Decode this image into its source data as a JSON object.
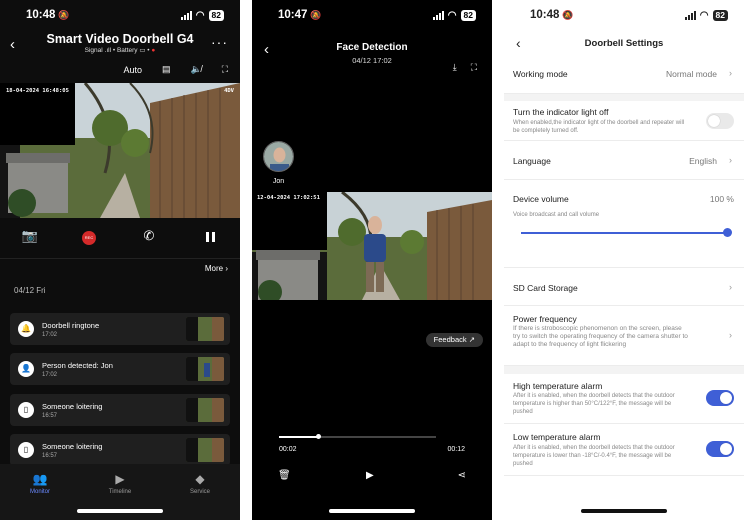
{
  "status": {
    "s1_time": "10:48",
    "s2_time": "10:47",
    "s3_time": "10:48",
    "battery": "82"
  },
  "s1": {
    "title": "Smart Video Doorbell G4",
    "signal_label": "Signal",
    "battery_label": "Battery",
    "quality": "Auto",
    "video_timestamp": "18-04-2024 16:48:05",
    "video_quality_tag": "4DV",
    "rec_label": "REC",
    "more": "More",
    "date": "04/12 Fri",
    "events": [
      {
        "title": "Doorbell ringtone",
        "time": "17:02",
        "icon": "bell-icon"
      },
      {
        "title": "Person detected: Jon",
        "time": "17:02",
        "icon": "person-icon"
      },
      {
        "title": "Someone loitering",
        "time": "16:57",
        "icon": "phone-icon"
      },
      {
        "title": "Someone loitering",
        "time": "16:57",
        "icon": "phone-icon"
      }
    ],
    "tabs": [
      {
        "label": "Monitor",
        "active": true
      },
      {
        "label": "Timeline",
        "active": false
      },
      {
        "label": "Service",
        "active": false
      }
    ]
  },
  "s2": {
    "title": "Face Detection",
    "date": "04/12 17:02",
    "face_name": "Jon",
    "video_timestamp": "12-04-2024 17:02:51",
    "feedback": "Feedback",
    "current_time": "00:02",
    "total_time": "00:12",
    "progress": 0.25
  },
  "s3": {
    "title": "Doorbell Settings",
    "working_mode": {
      "label": "Working mode",
      "value": "Normal mode"
    },
    "indicator": {
      "label": "Turn the indicator light off",
      "desc": "When enabled,the indicator light of the doorbell and repeater will be completely turned off.",
      "on": false
    },
    "language": {
      "label": "Language",
      "value": "English"
    },
    "volume": {
      "label": "Device volume",
      "value": "100 %",
      "desc": "Voice broadcast and call volume",
      "level": 1.0
    },
    "sd_card": {
      "label": "SD Card Storage"
    },
    "power_freq": {
      "label": "Power frequency",
      "desc": "If there is stroboscopic phenomenon on the screen, please try to switch the operating frequency of the camera shutter to adapt to the frequency of light flickering"
    },
    "high_temp": {
      "label": "High temperature alarm",
      "desc": "After it is enabled, when the doorbell detects that the outdoor temperature is higher than 50°C/122°F, the message will be pushed",
      "on": true
    },
    "low_temp": {
      "label": "Low temperature alarm",
      "desc": "After it is enabled, when the doorbell detects that the outdoor temperature is lower than -18°C/-0.4°F, the message will be pushed",
      "on": true
    }
  },
  "colors": {
    "accent": "#3f5fd6",
    "rec": "#d42a2a",
    "tab_active": "#6a89ff"
  }
}
